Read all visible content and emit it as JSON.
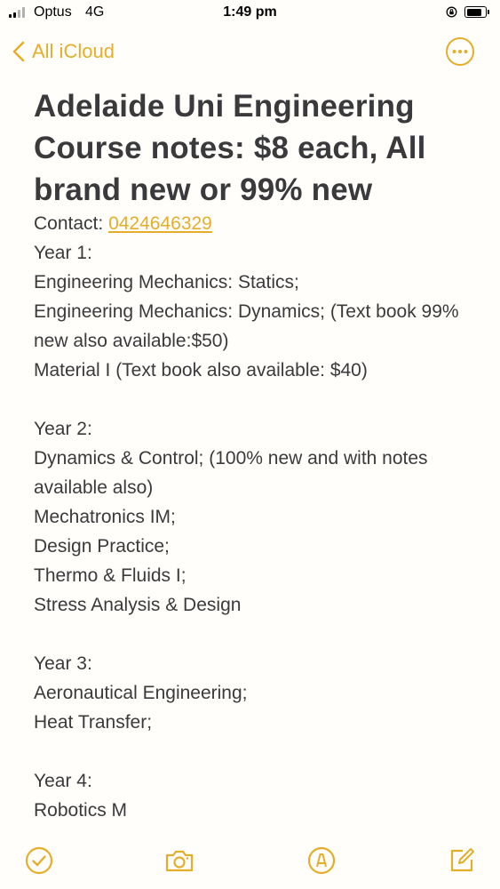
{
  "status_bar": {
    "carrier": "Optus",
    "network": "4G",
    "time": "1:49 pm",
    "signal_bars_active": 2,
    "signal_bars_total": 4,
    "icons": [
      "signal-icon",
      "rotation-lock-icon",
      "battery-icon"
    ]
  },
  "nav": {
    "back_label": "All iCloud",
    "accent_color": "#e4ae2a"
  },
  "note": {
    "title": "Adelaide Uni Engineering Course notes: $8 each, All brand new or 99% new",
    "contact_label": "Contact:",
    "contact_phone": "0424646329",
    "lines": [
      "Year 1:",
      "Engineering Mechanics: Statics;",
      "Engineering Mechanics: Dynamics; (Text book 99% new also available:$50)",
      "Material I (Text book also available: $40)",
      "",
      "Year 2:",
      "Dynamics & Control; (100% new and with notes available also)",
      "Mechatronics IM;",
      "Design Practice;",
      "Thermo & Fluids I;",
      "Stress Analysis & Design",
      "",
      "Year 3:",
      "Aeronautical Engineering;",
      "Heat Transfer;",
      "",
      "Year 4:",
      "Robotics M"
    ]
  },
  "toolbar": {
    "icons": [
      "checklist-icon",
      "camera-icon",
      "markup-icon",
      "compose-icon"
    ]
  }
}
